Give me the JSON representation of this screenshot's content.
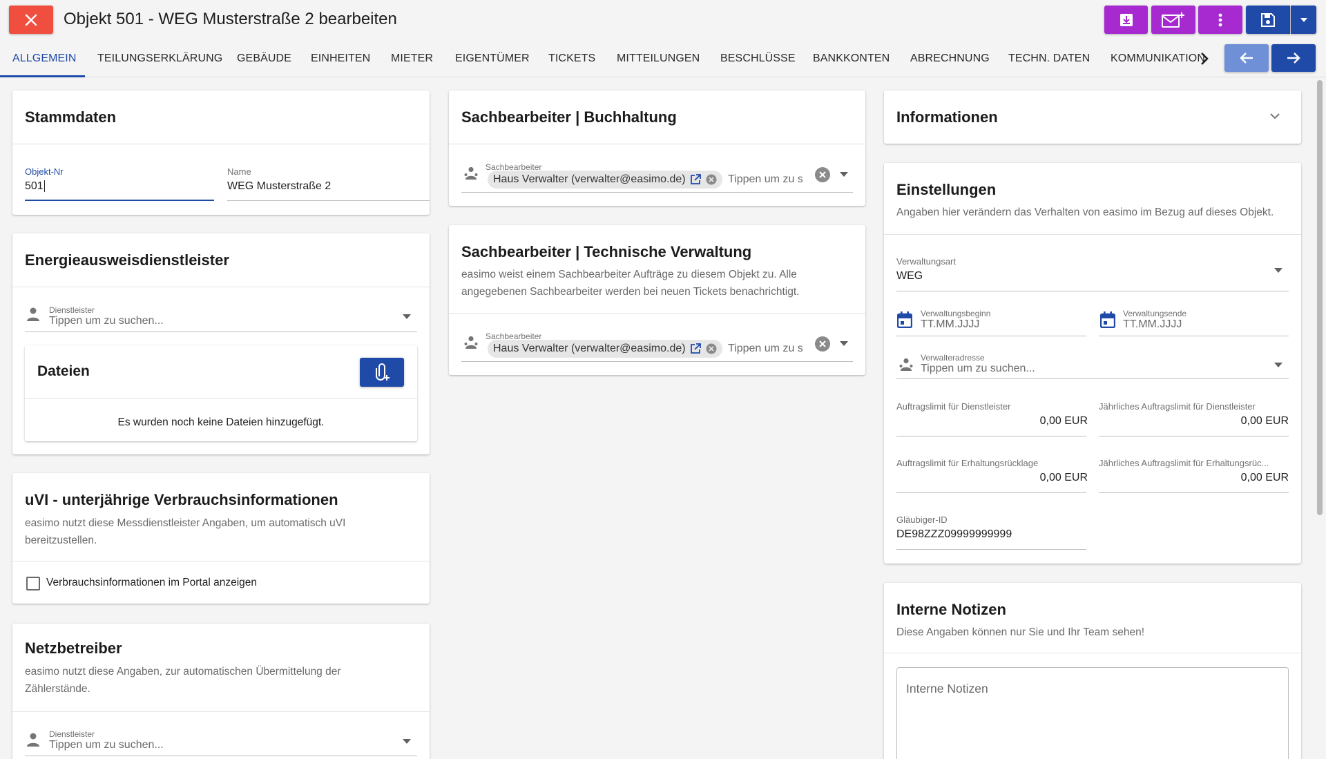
{
  "header": {
    "title": "Objekt 501 - WEG Musterstraße 2 bearbeiten",
    "close_icon": "close-icon",
    "actions": [
      "download-icon",
      "mail-add-icon",
      "more-vert-icon",
      "save-icon",
      "caret-down-icon"
    ]
  },
  "tabs": [
    {
      "label": "ALLGEMEIN",
      "active": true
    },
    {
      "label": "TEILUNGSERKLÄRUNG"
    },
    {
      "label": "GEBÄUDE"
    },
    {
      "label": "EINHEITEN"
    },
    {
      "label": "MIETER"
    },
    {
      "label": "EIGENTÜMER"
    },
    {
      "label": "TICKETS"
    },
    {
      "label": "MITTEILUNGEN"
    },
    {
      "label": "BESCHLÜSSE"
    },
    {
      "label": "BANKKONTEN"
    },
    {
      "label": "ABRECHNUNG"
    },
    {
      "label": "TECHN. DATEN"
    },
    {
      "label": "KOMMUNIKATION"
    }
  ],
  "stammdaten": {
    "title": "Stammdaten",
    "objekt_nr_label": "Objekt-Nr",
    "objekt_nr_value": "501",
    "name_label": "Name",
    "name_value": "WEG Musterstraße 2"
  },
  "energie": {
    "title": "Energieausweisdienstleister",
    "dienstleister_label": "Dienstleister",
    "dienstleister_placeholder": "Tippen um zu suchen...",
    "dateien_title": "Dateien",
    "dateien_empty": "Es wurden noch keine Dateien hinzugefügt."
  },
  "uvi": {
    "title": "uVI - unterjährige Verbrauchsinformationen",
    "subtitle": "easimo nutzt diese Messdienstleister Angaben, um automatisch uVI bereitzustellen.",
    "checkbox_label": "Verbrauchsinformationen im Portal anzeigen",
    "checked": false
  },
  "netzbetreiber": {
    "title": "Netzbetreiber",
    "subtitle": "easimo nutzt diese Angaben, zur automatischen Übermittelung der Zählerstände.",
    "dienstleister_label": "Dienstleister",
    "dienstleister_placeholder": "Tippen um zu suchen..."
  },
  "buchhaltung": {
    "title": "Sachbearbeiter | Buchhaltung",
    "field_label": "Sachbearbeiter",
    "chip": "Haus Verwalter (verwalter@easimo.de)",
    "input_placeholder": "Tippen um zu s"
  },
  "technik": {
    "title": "Sachbearbeiter | Technische Verwaltung",
    "subtitle": "easimo weist einem Sachbearbeiter Aufträge zu diesem Objekt zu. Alle angegebenen Sachbearbeiter werden bei neuen Tickets benachrichtigt.",
    "field_label": "Sachbearbeiter",
    "chip": "Haus Verwalter (verwalter@easimo.de)",
    "input_placeholder": "Tippen um zu s"
  },
  "informationen": {
    "title": "Informationen"
  },
  "einstellungen": {
    "title": "Einstellungen",
    "subtitle": "Angaben hier verändern das Verhalten von easimo im Bezug auf dieses Objekt.",
    "verwaltungsart_label": "Verwaltungsart",
    "verwaltungsart_value": "WEG",
    "beginn_label": "Verwaltungsbeginn",
    "beginn_placeholder": "TT.MM.JJJJ",
    "ende_label": "Verwaltungsende",
    "ende_placeholder": "TT.MM.JJJJ",
    "adresse_label": "Verwalteradresse",
    "adresse_placeholder": "Tippen um zu suchen...",
    "limit_dl_label": "Auftragslimit für Dienstleister",
    "limit_dl_value": "0,00 EUR",
    "limit_dl_year_label": "Jährliches Auftragslimit für Dienstleister",
    "limit_dl_year_value": "0,00 EUR",
    "limit_er_label": "Auftragslimit für Erhaltungsrücklage",
    "limit_er_value": "0,00 EUR",
    "limit_er_year_label": "Jährliches Auftragslimit für Erhaltungsrüc...",
    "limit_er_year_value": "0,00 EUR",
    "glaeubiger_label": "Gläubiger-ID",
    "glaeubiger_value": "DE98ZZZ09999999999"
  },
  "notizen": {
    "title": "Interne Notizen",
    "subtitle": "Diese Angaben können nur Sie und Ihr Team sehen!",
    "placeholder": "Interne Notizen"
  },
  "colors": {
    "accent": "#1f4aa8",
    "purple": "#a62ad0",
    "danger": "#f04e3f",
    "nav_back": "#6f8fd6"
  }
}
